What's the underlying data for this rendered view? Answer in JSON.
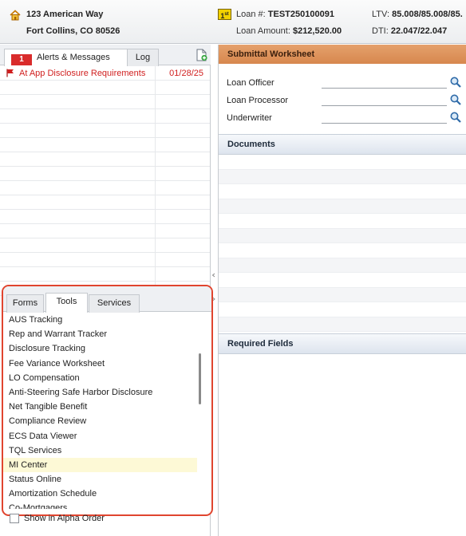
{
  "header": {
    "address_line1": "123 American Way",
    "address_line2": "Fort Collins, CO 80526",
    "lien_position": "1",
    "lien_suffix": "st",
    "loan_number_label": "Loan #:",
    "loan_number": "TEST250100091",
    "loan_amount_label": "Loan Amount:",
    "loan_amount": "$212,520.00",
    "ltv_label": "LTV:",
    "ltv_value": "85.008/85.008/85.",
    "dti_label": "DTI:",
    "dti_value": "22.047/22.047"
  },
  "left_tabs": {
    "alerts_count": "1",
    "alerts_label": "Alerts & Messages",
    "log_label": "Log"
  },
  "alerts": [
    {
      "text": "At App Disclosure Requirements",
      "date": "01/28/25"
    }
  ],
  "tools_tabs": {
    "forms": "Forms",
    "tools": "Tools",
    "services": "Services"
  },
  "tools_items": [
    "AUS Tracking",
    "Rep and Warrant Tracker",
    "Disclosure Tracking",
    "Fee Variance Worksheet",
    "LO Compensation",
    "Anti-Steering Safe Harbor Disclosure",
    "Net Tangible Benefit",
    "Compliance Review",
    "ECS Data Viewer",
    "TQL Services",
    "MI Center",
    "Status Online",
    "Amortization Schedule",
    "Co-Mortgagers"
  ],
  "selected_tool": "MI Center",
  "alpha_order_label": "Show in Alpha Order",
  "submittal": {
    "title": "Submittal Worksheet",
    "fields": [
      {
        "label": "Loan Officer",
        "value": ""
      },
      {
        "label": "Loan Processor",
        "value": ""
      },
      {
        "label": "Underwriter",
        "value": ""
      }
    ],
    "documents_title": "Documents",
    "required_fields_title": "Required Fields"
  },
  "colors": {
    "alert_red": "#d01f1f",
    "worksheet_orange": "#d98a52",
    "highlight_border": "#e0452f",
    "selected_row": "#fdf9d6"
  }
}
